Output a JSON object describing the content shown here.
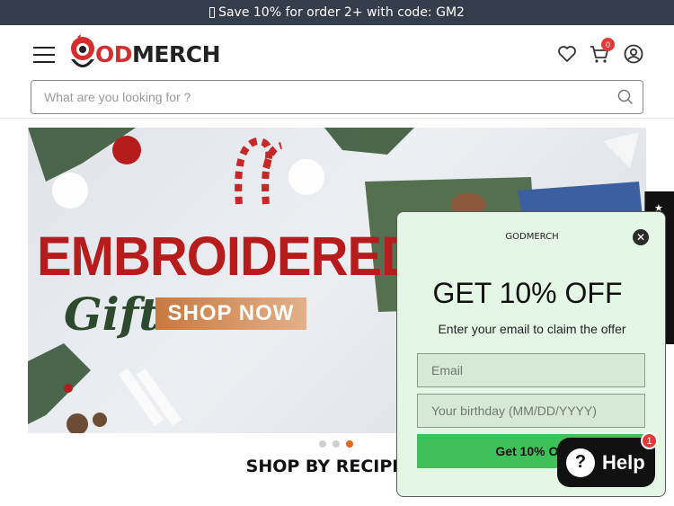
{
  "announcement": {
    "text": "Save 10% for order 2+ with code: GM2"
  },
  "header": {
    "logo_prefix": "OD",
    "logo_suffix": "MERCH",
    "cart_count": "0"
  },
  "search": {
    "placeholder": "What are you looking for ?"
  },
  "banner": {
    "headline": "EMBROIDERED",
    "script_text": "Gift",
    "cta": "SHOP NOW",
    "slides": 3,
    "active_slide": 3
  },
  "section": {
    "title": "SHOP BY RECIPIE"
  },
  "popup": {
    "brand": "GODMERCH",
    "close": "✕",
    "title": "GET 10% OFF",
    "subtitle": "Enter your email to claim the offer",
    "email_placeholder": "Email",
    "birthday_placeholder": "Your birthday (MM/DD/YYYY)",
    "button": "Get 10% Off"
  },
  "side_tab": {
    "label": "★"
  },
  "help": {
    "label": "Help",
    "icon": "?",
    "badge": "1"
  },
  "colors": {
    "accent": "#e53935",
    "popup_bg": "#e4f6e4",
    "button_green": "#3fc15a",
    "topbar": "#343d4b"
  }
}
